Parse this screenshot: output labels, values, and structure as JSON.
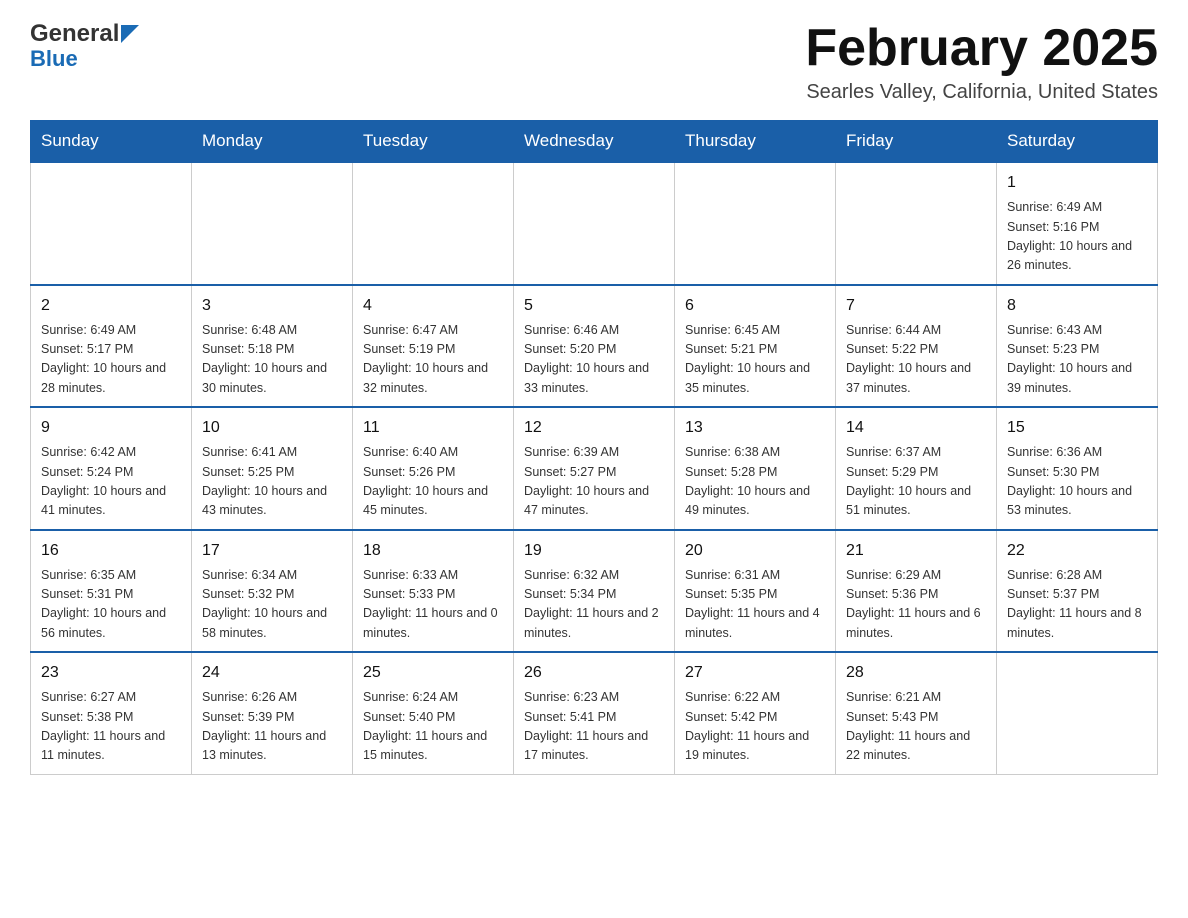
{
  "header": {
    "logo_general": "General",
    "logo_blue": "Blue",
    "title": "February 2025",
    "subtitle": "Searles Valley, California, United States"
  },
  "days_of_week": [
    "Sunday",
    "Monday",
    "Tuesday",
    "Wednesday",
    "Thursday",
    "Friday",
    "Saturday"
  ],
  "weeks": [
    [
      {
        "day": "",
        "info": ""
      },
      {
        "day": "",
        "info": ""
      },
      {
        "day": "",
        "info": ""
      },
      {
        "day": "",
        "info": ""
      },
      {
        "day": "",
        "info": ""
      },
      {
        "day": "",
        "info": ""
      },
      {
        "day": "1",
        "info": "Sunrise: 6:49 AM\nSunset: 5:16 PM\nDaylight: 10 hours and 26 minutes."
      }
    ],
    [
      {
        "day": "2",
        "info": "Sunrise: 6:49 AM\nSunset: 5:17 PM\nDaylight: 10 hours and 28 minutes."
      },
      {
        "day": "3",
        "info": "Sunrise: 6:48 AM\nSunset: 5:18 PM\nDaylight: 10 hours and 30 minutes."
      },
      {
        "day": "4",
        "info": "Sunrise: 6:47 AM\nSunset: 5:19 PM\nDaylight: 10 hours and 32 minutes."
      },
      {
        "day": "5",
        "info": "Sunrise: 6:46 AM\nSunset: 5:20 PM\nDaylight: 10 hours and 33 minutes."
      },
      {
        "day": "6",
        "info": "Sunrise: 6:45 AM\nSunset: 5:21 PM\nDaylight: 10 hours and 35 minutes."
      },
      {
        "day": "7",
        "info": "Sunrise: 6:44 AM\nSunset: 5:22 PM\nDaylight: 10 hours and 37 minutes."
      },
      {
        "day": "8",
        "info": "Sunrise: 6:43 AM\nSunset: 5:23 PM\nDaylight: 10 hours and 39 minutes."
      }
    ],
    [
      {
        "day": "9",
        "info": "Sunrise: 6:42 AM\nSunset: 5:24 PM\nDaylight: 10 hours and 41 minutes."
      },
      {
        "day": "10",
        "info": "Sunrise: 6:41 AM\nSunset: 5:25 PM\nDaylight: 10 hours and 43 minutes."
      },
      {
        "day": "11",
        "info": "Sunrise: 6:40 AM\nSunset: 5:26 PM\nDaylight: 10 hours and 45 minutes."
      },
      {
        "day": "12",
        "info": "Sunrise: 6:39 AM\nSunset: 5:27 PM\nDaylight: 10 hours and 47 minutes."
      },
      {
        "day": "13",
        "info": "Sunrise: 6:38 AM\nSunset: 5:28 PM\nDaylight: 10 hours and 49 minutes."
      },
      {
        "day": "14",
        "info": "Sunrise: 6:37 AM\nSunset: 5:29 PM\nDaylight: 10 hours and 51 minutes."
      },
      {
        "day": "15",
        "info": "Sunrise: 6:36 AM\nSunset: 5:30 PM\nDaylight: 10 hours and 53 minutes."
      }
    ],
    [
      {
        "day": "16",
        "info": "Sunrise: 6:35 AM\nSunset: 5:31 PM\nDaylight: 10 hours and 56 minutes."
      },
      {
        "day": "17",
        "info": "Sunrise: 6:34 AM\nSunset: 5:32 PM\nDaylight: 10 hours and 58 minutes."
      },
      {
        "day": "18",
        "info": "Sunrise: 6:33 AM\nSunset: 5:33 PM\nDaylight: 11 hours and 0 minutes."
      },
      {
        "day": "19",
        "info": "Sunrise: 6:32 AM\nSunset: 5:34 PM\nDaylight: 11 hours and 2 minutes."
      },
      {
        "day": "20",
        "info": "Sunrise: 6:31 AM\nSunset: 5:35 PM\nDaylight: 11 hours and 4 minutes."
      },
      {
        "day": "21",
        "info": "Sunrise: 6:29 AM\nSunset: 5:36 PM\nDaylight: 11 hours and 6 minutes."
      },
      {
        "day": "22",
        "info": "Sunrise: 6:28 AM\nSunset: 5:37 PM\nDaylight: 11 hours and 8 minutes."
      }
    ],
    [
      {
        "day": "23",
        "info": "Sunrise: 6:27 AM\nSunset: 5:38 PM\nDaylight: 11 hours and 11 minutes."
      },
      {
        "day": "24",
        "info": "Sunrise: 6:26 AM\nSunset: 5:39 PM\nDaylight: 11 hours and 13 minutes."
      },
      {
        "day": "25",
        "info": "Sunrise: 6:24 AM\nSunset: 5:40 PM\nDaylight: 11 hours and 15 minutes."
      },
      {
        "day": "26",
        "info": "Sunrise: 6:23 AM\nSunset: 5:41 PM\nDaylight: 11 hours and 17 minutes."
      },
      {
        "day": "27",
        "info": "Sunrise: 6:22 AM\nSunset: 5:42 PM\nDaylight: 11 hours and 19 minutes."
      },
      {
        "day": "28",
        "info": "Sunrise: 6:21 AM\nSunset: 5:43 PM\nDaylight: 11 hours and 22 minutes."
      },
      {
        "day": "",
        "info": ""
      }
    ]
  ]
}
